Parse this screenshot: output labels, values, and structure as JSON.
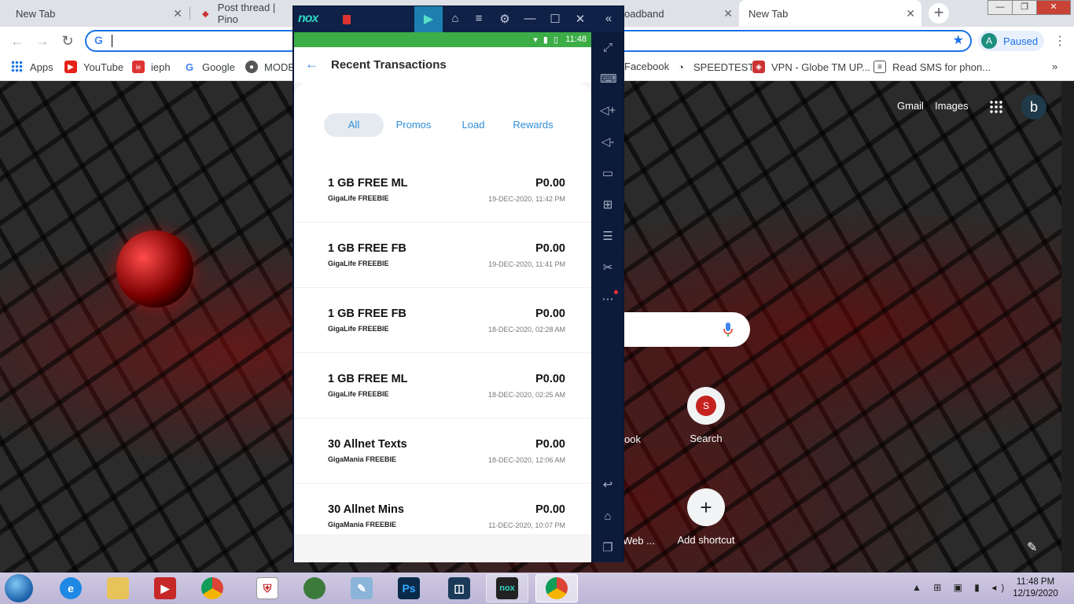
{
  "browser": {
    "tabs": [
      {
        "label": "New Tab"
      },
      {
        "label": "Post thread | Pino"
      },
      {
        "label": "oadband"
      },
      {
        "label": "New Tab"
      }
    ],
    "omnibox_value": "",
    "profile_initial": "A",
    "profile_status": "Paused",
    "bookmarks": [
      {
        "label": "Apps"
      },
      {
        "label": "YouTube"
      },
      {
        "label": "ieph"
      },
      {
        "label": "Google"
      },
      {
        "label": "MODE"
      },
      {
        "label": "Facebook"
      },
      {
        "label": "SPEEDTEST"
      },
      {
        "label": "VPN - Globe TM UP..."
      },
      {
        "label": "Read SMS for phon..."
      }
    ],
    "more_bookmarks": "»"
  },
  "ntp": {
    "gmail": "Gmail",
    "images": "Images",
    "avatar_initial": "b",
    "shortcuts": [
      {
        "label": "Search",
        "icon_letter": "S"
      },
      {
        "label": "Add shortcut",
        "icon": "+"
      }
    ],
    "peek_labels": [
      "ook",
      "Web ..."
    ]
  },
  "nox": {
    "logo": "nox",
    "status_time": "11:48",
    "screen_title": "Recent Transactions",
    "filters": [
      "All",
      "Promos",
      "Load",
      "Rewards"
    ],
    "active_filter": "All",
    "transactions": [
      {
        "name": "1 GB FREE ML",
        "source": "GigaLife FREEBIE",
        "amount": "P0.00",
        "date": "19-DEC-2020, 11:42 PM"
      },
      {
        "name": "1 GB FREE FB",
        "source": "GigaLife FREEBIE",
        "amount": "P0.00",
        "date": "19-DEC-2020, 11:41 PM"
      },
      {
        "name": "1 GB FREE FB",
        "source": "GigaLife FREEBIE",
        "amount": "P0.00",
        "date": "18-DEC-2020, 02:28 AM"
      },
      {
        "name": "1 GB FREE ML",
        "source": "GigaLife FREEBIE",
        "amount": "P0.00",
        "date": "18-DEC-2020, 02:25 AM"
      },
      {
        "name": "30 Allnet Texts",
        "source": "GigaMania FREEBIE",
        "amount": "P0.00",
        "date": "18-DEC-2020, 12:06 AM"
      },
      {
        "name": "30 Allnet Mins",
        "source": "GigaMania FREEBIE",
        "amount": "P0.00",
        "date": "11-DEC-2020, 10:07 PM"
      }
    ]
  },
  "taskbar": {
    "clock_time": "11:48 PM",
    "clock_date": "12/19/2020"
  },
  "colors": {
    "status_bar": "#3cad47",
    "accent_blue": "#2f8fd8",
    "nox_frame": "#0d1b3a"
  }
}
